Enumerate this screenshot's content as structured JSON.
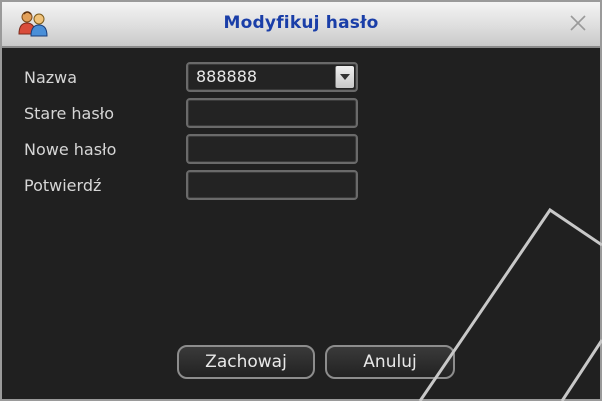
{
  "dialog": {
    "title": "Modyfikuj hasło",
    "icons": {
      "app": "people-icon",
      "close": "close-icon",
      "dropdown": "chevron-down-icon"
    }
  },
  "form": {
    "name_label": "Nazwa",
    "name_value": "888888",
    "old_password_label": "Stare hasło",
    "old_password_value": "",
    "new_password_label": "Nowe hasło",
    "new_password_value": "",
    "confirm_label": "Potwierdź",
    "confirm_value": ""
  },
  "buttons": {
    "save_label": "Zachowaj",
    "cancel_label": "Anuluj"
  },
  "colors": {
    "title_text": "#1a3ea8",
    "background": "#202020",
    "label_text": "#d6d6d6"
  }
}
